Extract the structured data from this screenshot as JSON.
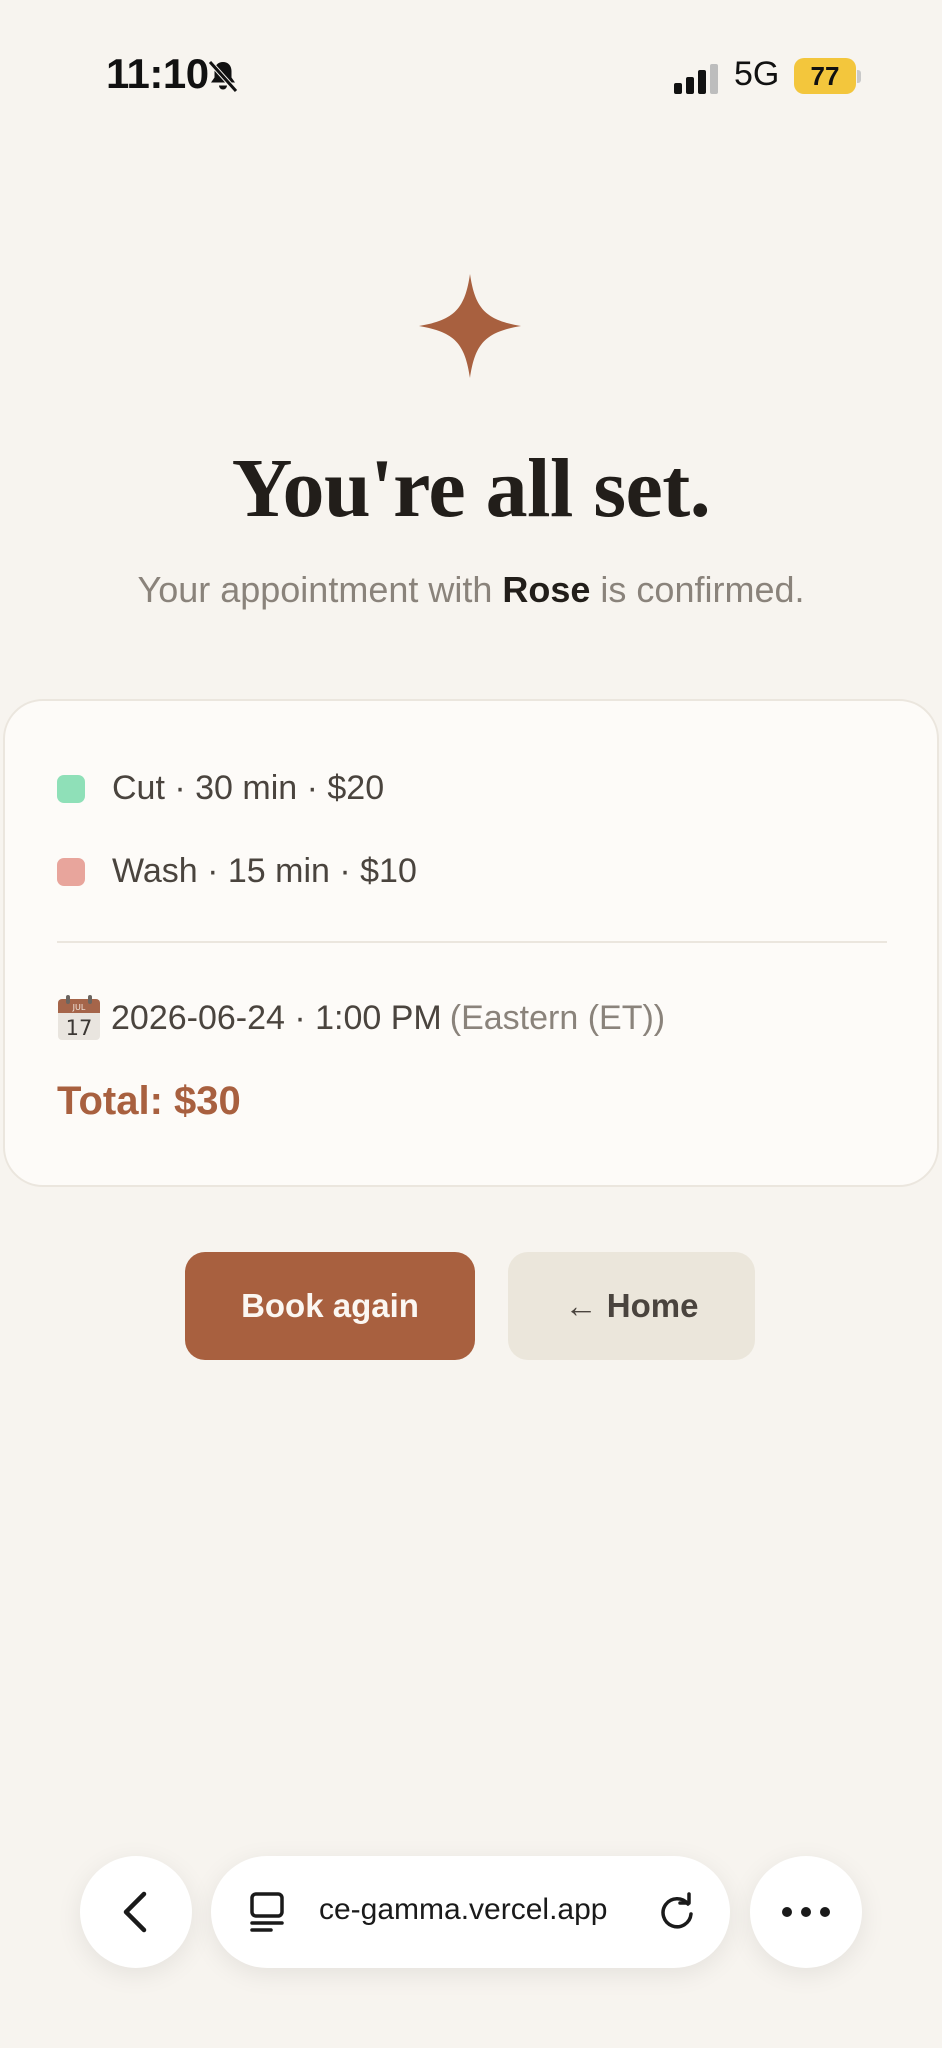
{
  "status_bar": {
    "time": "11:10",
    "network": "5G",
    "battery": "77"
  },
  "hero": {
    "title": "You're all set.",
    "subtitle_prefix": "Your appointment with ",
    "stylist_name": "Rose",
    "subtitle_suffix": " is confirmed."
  },
  "summary": {
    "services": [
      {
        "label": "Cut · 30 min · $20",
        "color": "#8fe0b8"
      },
      {
        "label": "Wash · 15 min · $10",
        "color": "#e8a59c"
      }
    ],
    "calendar_icon_month": "JUL",
    "calendar_icon_day": "17",
    "datetime": "2026-06-24 · 1:00 PM",
    "timezone": "(Eastern (ET))",
    "total": "Total: $30"
  },
  "actions": {
    "book_again_label": "Book again",
    "home_label": "← Home"
  },
  "browser": {
    "url": "ce-gamma.vercel.app"
  },
  "colors": {
    "accent": "#a8603f",
    "background": "#f7f4ef",
    "card": "#fdfbf8"
  }
}
